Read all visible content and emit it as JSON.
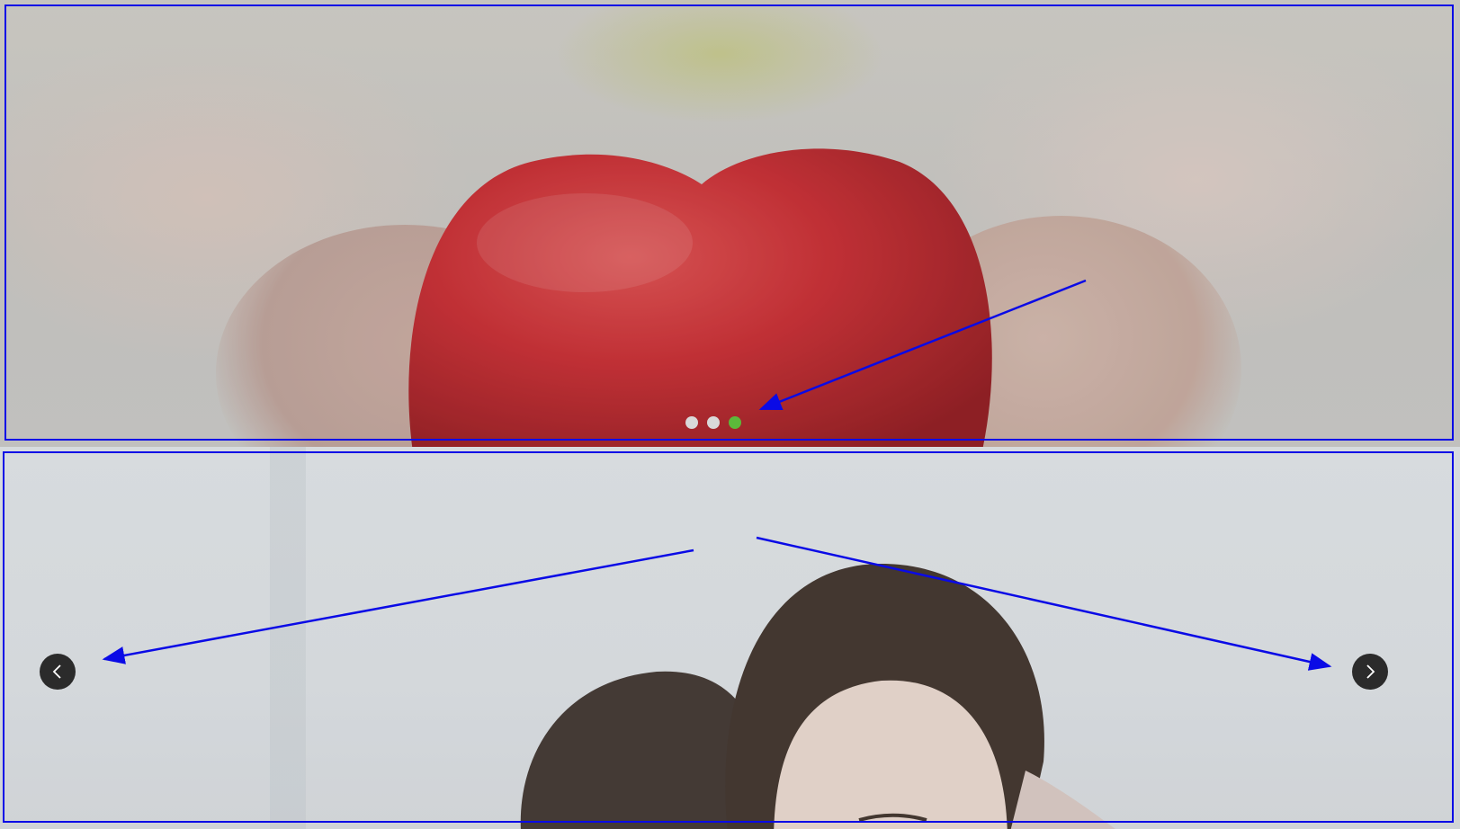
{
  "top_slider": {
    "pagination": {
      "count": 3,
      "active_index": 2,
      "inactive_color": "#d9d9d9",
      "active_color": "#5cb93a"
    },
    "image_icon": "heart-in-hands-image"
  },
  "bottom_slider": {
    "image_icon": "two-people-embracing-image",
    "prev_icon": "chevron-left-icon",
    "next_icon": "chevron-right-icon",
    "button_color": "#2b2b2b"
  },
  "annotations": {
    "color": "#0a0ae6"
  }
}
